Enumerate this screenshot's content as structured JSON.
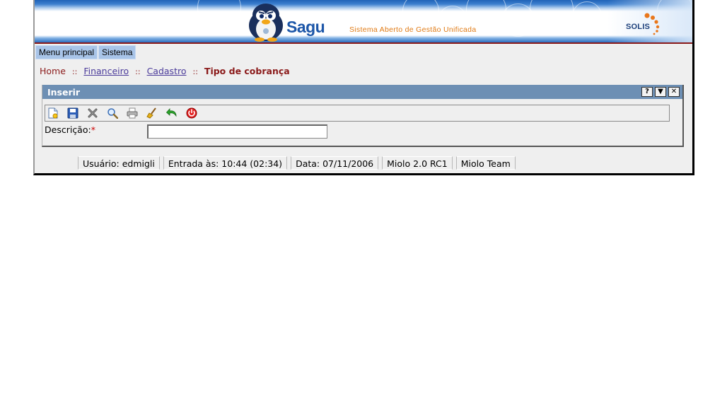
{
  "header": {
    "logo_text": "Sagu",
    "tagline": "Sistema Aberto de Gestão Unificada",
    "partner_logo": "SOLIS"
  },
  "menu": {
    "items": [
      {
        "label": "Menu principal"
      },
      {
        "label": "Sistema"
      }
    ]
  },
  "breadcrumb": {
    "home": "Home",
    "separator": "::",
    "links": [
      {
        "label": "Financeiro"
      },
      {
        "label": "Cadastro"
      }
    ],
    "current": "Tipo de cobrança"
  },
  "panel": {
    "title": "Inserir",
    "window_buttons": {
      "help": "?",
      "minimize": "▼",
      "close": "✕"
    },
    "toolbar": [
      {
        "icon": "new-document-icon"
      },
      {
        "icon": "save-icon"
      },
      {
        "icon": "delete-icon"
      },
      {
        "icon": "search-icon"
      },
      {
        "icon": "print-icon"
      },
      {
        "icon": "clear-icon"
      },
      {
        "icon": "back-icon"
      },
      {
        "icon": "exit-icon"
      }
    ],
    "form": {
      "description_label": "Descrição:",
      "required_mark": "*",
      "description_value": ""
    }
  },
  "statusbar": {
    "user": "Usuário: edmigli",
    "login_time": "Entrada às: 10:44 (02:34)",
    "date": "Data: 07/11/2006",
    "version": "Miolo 2.0 RC1",
    "team": "Miolo Team"
  },
  "colors": {
    "banner_blue": "#1f63b8",
    "accent_red": "#8b1a1a",
    "panel_title": "#6d8fb4",
    "menu_bg": "#a8c4e8",
    "tagline_orange": "#e07a14"
  }
}
